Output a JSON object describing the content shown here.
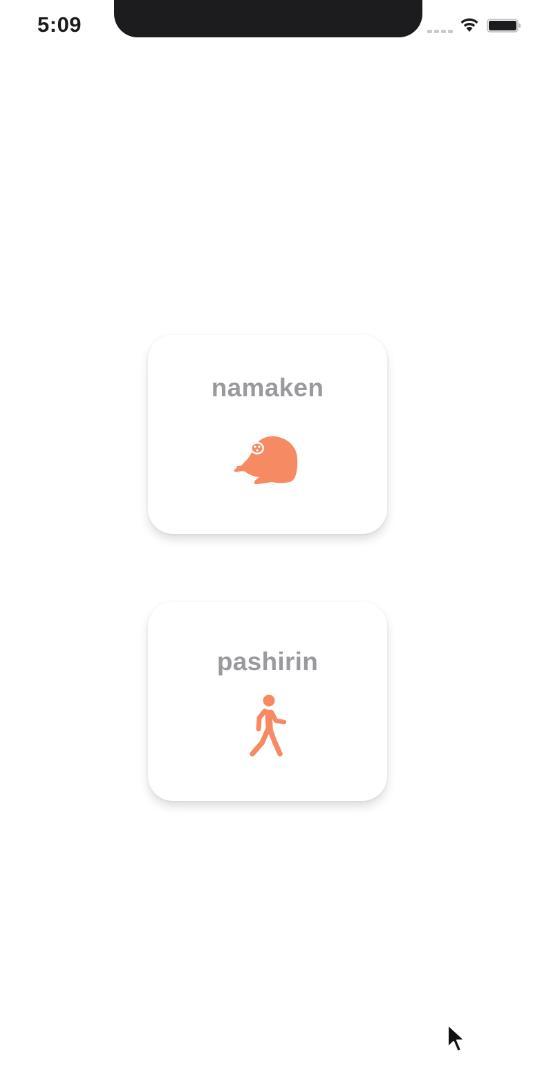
{
  "status_bar": {
    "time": "5:09"
  },
  "colors": {
    "accent": "#f68a63",
    "title_gray": "#9a9a9e",
    "background": "#ffffff"
  },
  "cards": [
    {
      "title": "namaken",
      "icon": "sloth-icon"
    },
    {
      "title": "pashirin",
      "icon": "walking-person-icon"
    }
  ]
}
